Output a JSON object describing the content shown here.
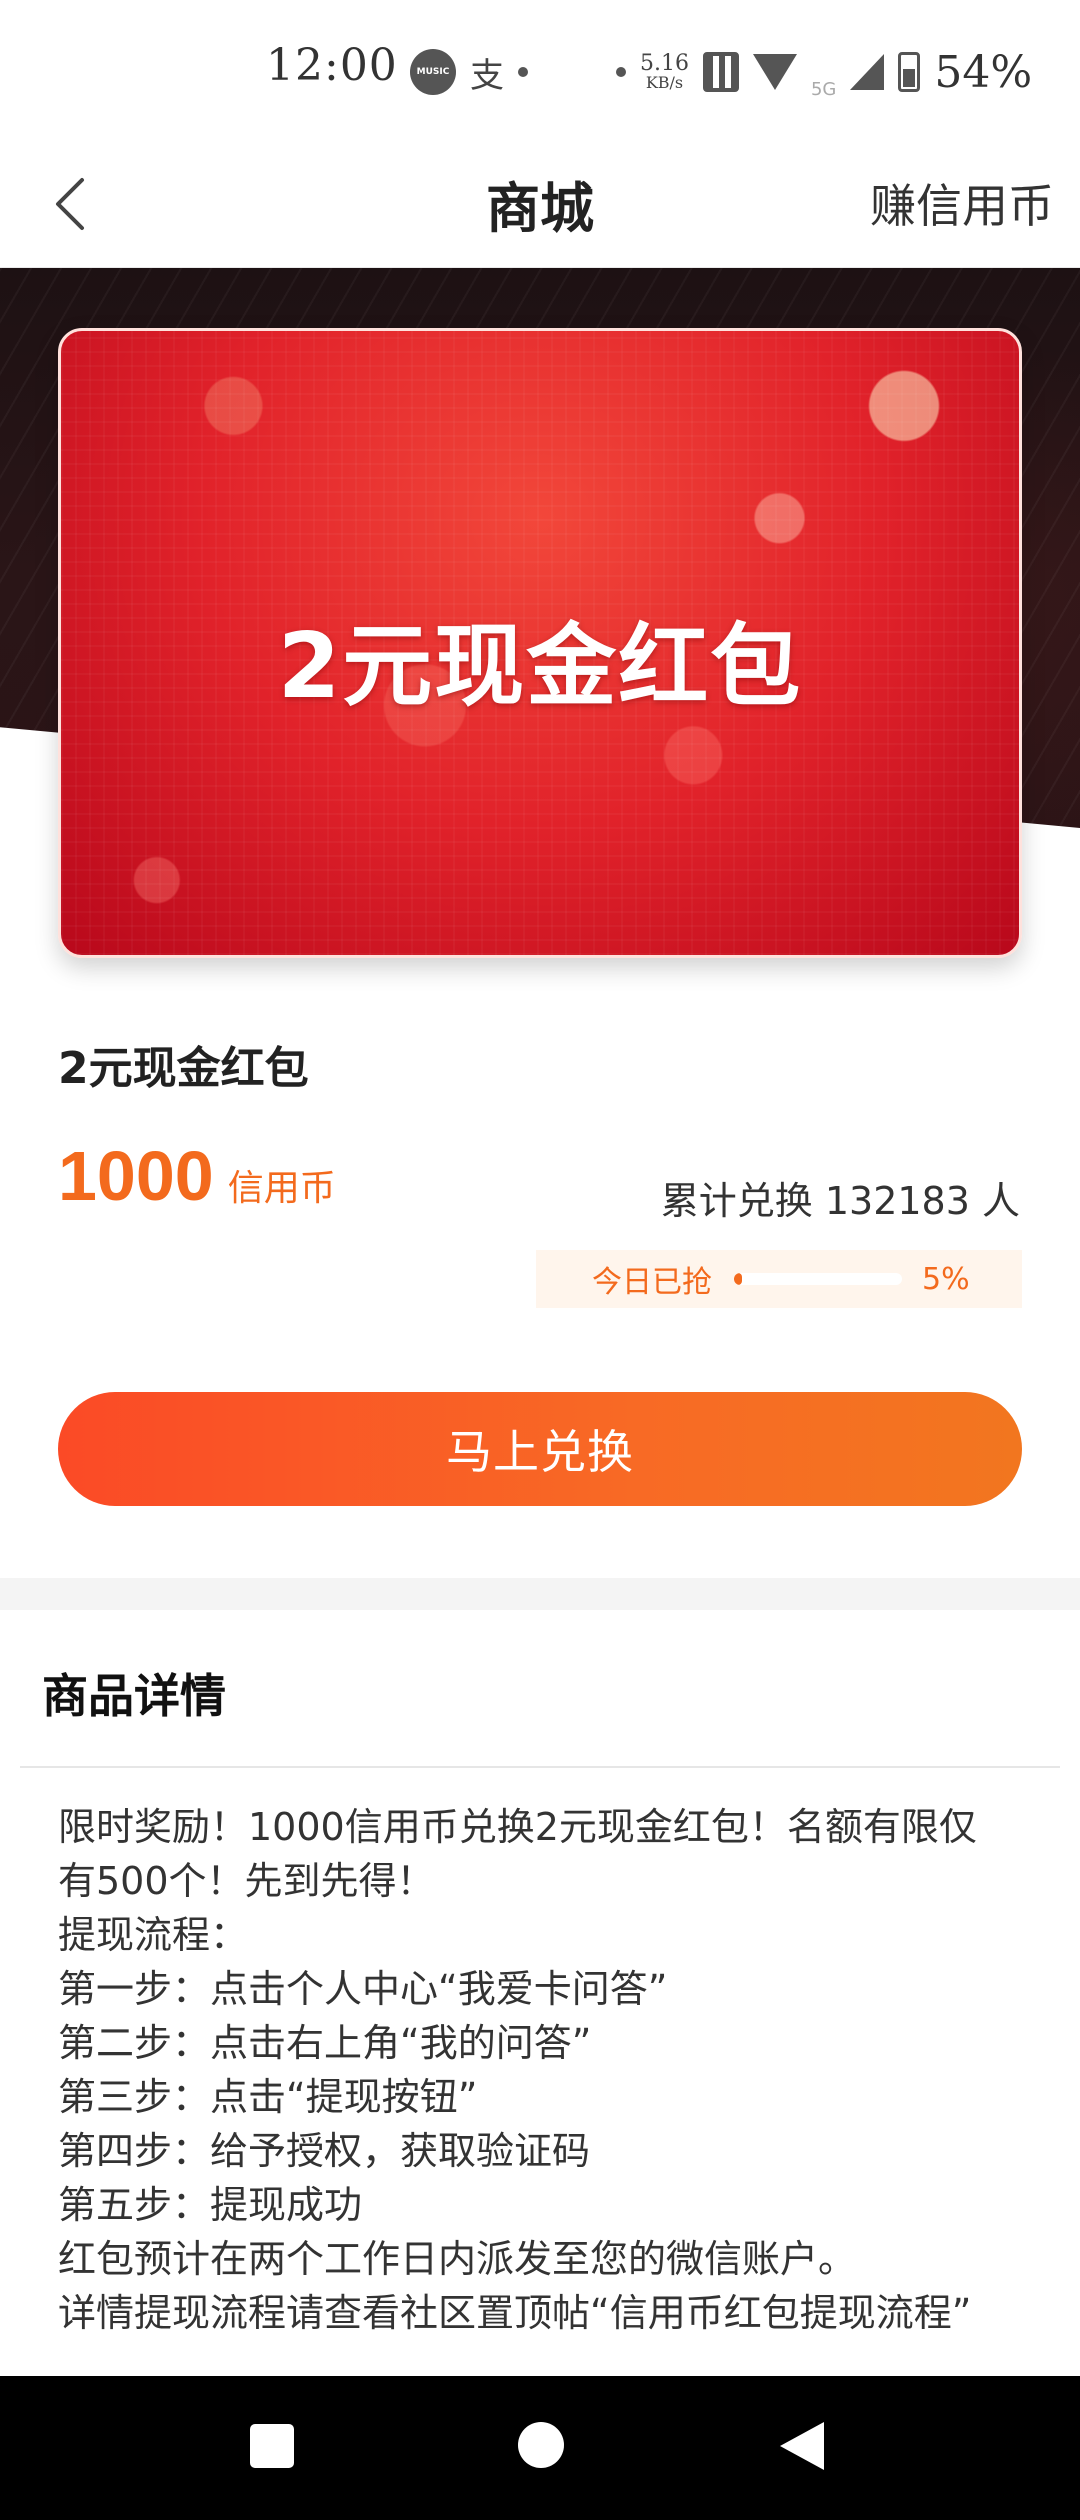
{
  "status_bar": {
    "time": "12:00",
    "music_label": "MUSIC",
    "alipay_glyph": "支",
    "speed_value": "5.16",
    "speed_unit": "KB/s",
    "network": "5G",
    "battery": "54%"
  },
  "nav": {
    "back_icon": "chevron-left-icon",
    "title": "商城",
    "right_action": "赚信用币"
  },
  "hero": {
    "card_title": "2元现金红包",
    "colors": {
      "card_red": "#e1222a",
      "backdrop": "#2a1517"
    }
  },
  "product": {
    "name": "2元现金红包",
    "price_value": "1000",
    "price_unit": "信用币",
    "redeem_count": "累计兑换 132183 人",
    "progress_label": "今日已抢",
    "progress_percent_text": "5%",
    "progress_fraction": 0.05,
    "accent_color": "#f36a1d"
  },
  "actions": {
    "redeem_button": "马上兑换"
  },
  "detail": {
    "title": "商品详情",
    "lines": [
      "限时奖励！1000信用币兑换2元现金红包！名额有限仅",
      "有500个！先到先得！",
      "提现流程：",
      "第一步：点击个人中心“我爱卡问答”",
      "第二步：点击右上角“我的问答”",
      "第三步：点击“提现按钮”",
      "第四步：给予授权，获取验证码",
      "第五步：提现成功",
      "红包预计在两个工作日内派发至您的微信账户。",
      "详情提现流程请查看社区置顶帖“信用币红包提现流程”"
    ]
  },
  "system_nav": {
    "recents_icon": "square-icon",
    "home_icon": "circle-icon",
    "back_icon": "triangle-back-icon"
  }
}
